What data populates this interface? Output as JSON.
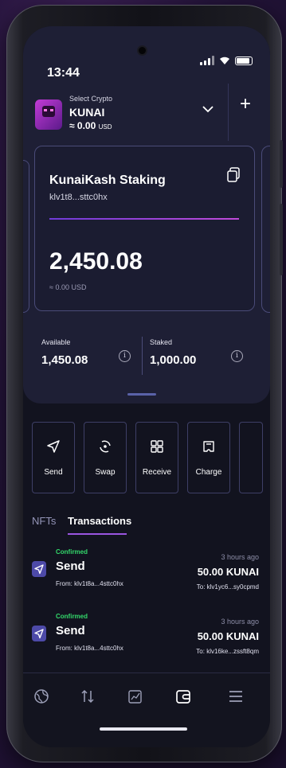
{
  "status_bar": {
    "time": "13:44"
  },
  "header": {
    "select_label": "Select Crypto",
    "crypto_name": "KUNAI",
    "crypto_balance": "≈ 0.00",
    "crypto_balance_unit": "USD"
  },
  "staking_card": {
    "title": "KunaiKash Staking",
    "address": "klv1t8...sttc0hx",
    "amount": "2,450.08",
    "usd": "≈ 0.00 USD"
  },
  "balances": {
    "available_label": "Available",
    "available_value": "1,450.08",
    "staked_label": "Staked",
    "staked_value": "1,000.00"
  },
  "actions": [
    {
      "label": "Send",
      "icon": "send-icon"
    },
    {
      "label": "Swap",
      "icon": "swap-icon"
    },
    {
      "label": "Receive",
      "icon": "qr-icon"
    },
    {
      "label": "Charge",
      "icon": "charge-icon"
    }
  ],
  "tabs": {
    "nfts": "NFTs",
    "transactions": "Transactions"
  },
  "transactions": [
    {
      "status": "Confirmed",
      "type": "Send",
      "from": "From:  klv1t8a...4sttc0hx",
      "time": "3 hours ago",
      "amount": "50.00 KUNAI",
      "to": "To:  klv1yc6...sy0cpmd"
    },
    {
      "status": "Confirmed",
      "type": "Send",
      "from": "From:  klv1t8a...4sttc0hx",
      "time": "3 hours ago",
      "amount": "50.00 KUNAI",
      "to": "To:  klv16ke...zssft8qm"
    }
  ],
  "bottom_nav": [
    "globe-icon",
    "transfer-icon",
    "chart-icon",
    "wallet-icon",
    "menu-icon"
  ],
  "colors": {
    "accent": "#9a55e0",
    "confirmed": "#33d96b",
    "card_bg": "#1e1f35"
  }
}
